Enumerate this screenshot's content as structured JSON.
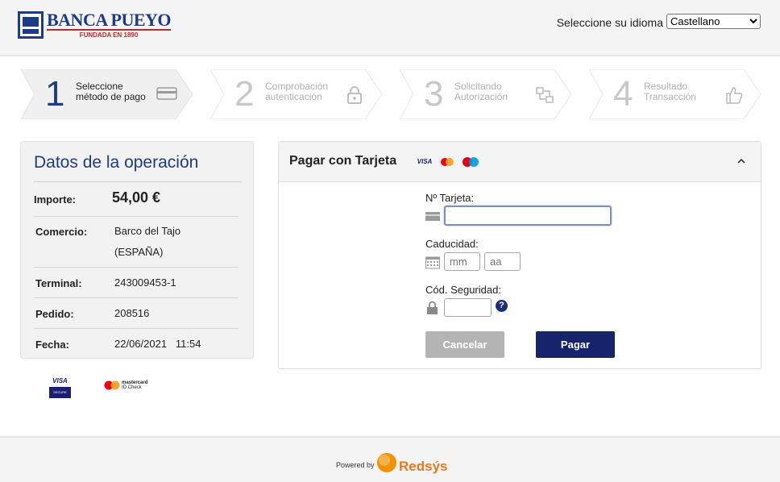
{
  "header": {
    "bank_name": "BANCA PUEYO",
    "bank_tagline": "FUNDADA EN 1890",
    "language_label": "Seleccione su idioma",
    "language_selected": "Castellano",
    "brand_color": "#1e3b86"
  },
  "steps": [
    {
      "number": "1",
      "line1": "Seleccione",
      "line2": "método de pago",
      "icon": "credit-card-icon",
      "active": true
    },
    {
      "number": "2",
      "line1": "Comprobación",
      "line2": "autenticación",
      "icon": "padlock-icon",
      "active": false
    },
    {
      "number": "3",
      "line1": "Solicitando",
      "line2": "Autorización",
      "icon": "transfer-icon",
      "active": false
    },
    {
      "number": "4",
      "line1": "Resultado",
      "line2": "Transacción",
      "icon": "thumbs-up-icon",
      "active": false
    }
  ],
  "operation": {
    "title": "Datos de la operación",
    "amount_label": "Importe:",
    "amount_value": "54,00 €",
    "merchant_label": "Comercio:",
    "merchant_line1": "Barco del Tajo",
    "merchant_line2": "(ESPAÑA)",
    "terminal_label": "Terminal:",
    "terminal_value": "243009453-1",
    "order_label": "Pedido:",
    "order_value": "208516",
    "date_label": "Fecha:",
    "date_value": "22/06/2021",
    "time_value": "11:54"
  },
  "badges": {
    "visa_secure_top": "VISA",
    "visa_secure_bottom": "SECURE",
    "mastercard_line1": "mastercard",
    "mastercard_line2": "ID Check"
  },
  "card_form": {
    "title": "Pagar con Tarjeta",
    "brands": [
      "VISA",
      "mastercard",
      "Maestro"
    ],
    "card_number_label": "Nº Tarjeta:",
    "card_number_value": "",
    "expiry_label": "Caducidad:",
    "month_placeholder": "mm",
    "year_placeholder": "aa",
    "cvv_label": "Cód. Seguridad:",
    "cvv_value": "",
    "help_glyph": "?",
    "cancel_label": "Cancelar",
    "pay_label": "Pagar"
  },
  "footer": {
    "powered_by": "Powered by",
    "provider": "Redsýs"
  }
}
